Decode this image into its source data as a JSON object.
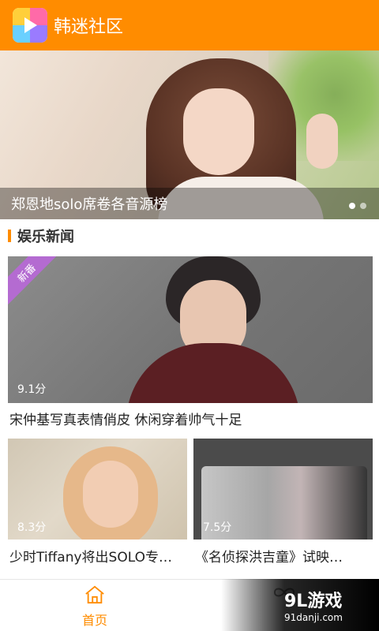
{
  "header": {
    "title": "韩迷社区"
  },
  "banner": {
    "caption": "郑恩地solo席卷各音源榜"
  },
  "section": {
    "title": "娱乐新闻"
  },
  "cards": [
    {
      "badge": "新番",
      "score": "9.1分",
      "title": "宋仲基写真表情俏皮 休闲穿着帅气十足"
    },
    {
      "score": "8.3分",
      "title": "少时Tiffany将出SOLO专…"
    },
    {
      "score": "7.5分",
      "title": "《名侦探洪吉童》试映…"
    }
  ],
  "bottom_nav": {
    "home_label": "首页"
  },
  "watermark": {
    "main": "9L游戏",
    "sub": "91danji.com"
  },
  "colors": {
    "accent": "#ff8c00",
    "badge": "#b46bd1"
  },
  "icons": {
    "home": "home-icon",
    "second_nav": "infinity-icon"
  }
}
